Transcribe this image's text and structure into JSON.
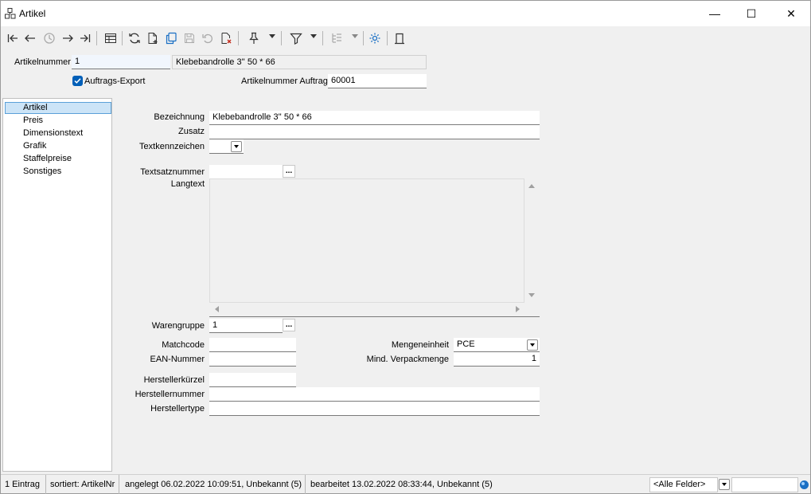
{
  "window": {
    "title": "Artikel",
    "minimize": "—",
    "maximize": "☐",
    "close": "✕"
  },
  "header": {
    "artikelnummer_label": "Artikelnummer",
    "artikelnummer_value": "1",
    "artikel_name": "Klebebandrolle 3'' 50 * 66",
    "auftrags_export_label": "Auftrags-Export",
    "auftrags_export_checked": true,
    "artikelnummer_auftrag_label": "Artikelnummer Auftrag",
    "artikelnummer_auftrag_value": "60001"
  },
  "nav": {
    "items": [
      {
        "label": "Artikel",
        "selected": true
      },
      {
        "label": "Preis",
        "selected": false
      },
      {
        "label": "Dimensionstext",
        "selected": false
      },
      {
        "label": "Grafik",
        "selected": false
      },
      {
        "label": "Staffelpreise",
        "selected": false
      },
      {
        "label": "Sonstiges",
        "selected": false
      }
    ]
  },
  "form": {
    "bezeichnung_label": "Bezeichnung",
    "bezeichnung_value": "Klebebandrolle 3'' 50 * 66",
    "zusatz_label": "Zusatz",
    "zusatz_value": "",
    "textkennzeichen_label": "Textkennzeichen",
    "textkennzeichen_value": "",
    "textsatznummer_label": "Textsatznummer",
    "textsatznummer_value": "",
    "ellipsis": "...",
    "langtext_label": "Langtext",
    "langtext_value": "",
    "warengruppe_label": "Warengruppe",
    "warengruppe_value": "1",
    "matchcode_label": "Matchcode",
    "matchcode_value": "",
    "ean_label": "EAN-Nummer",
    "ean_value": "",
    "mengeneinheit_label": "Mengeneinheit",
    "mengeneinheit_value": "PCE",
    "mind_verpackmenge_label": "Mind. Verpackmenge",
    "mind_verpackmenge_value": "1",
    "herstellerkuerzel_label": "Herstellerkürzel",
    "herstellerkuerzel_value": "",
    "herstellernummer_label": "Herstellernummer",
    "herstellernummer_value": "",
    "herstellertype_label": "Herstellertype",
    "herstellertype_value": ""
  },
  "status": {
    "count": "1 Eintrag",
    "sorted": "sortiert: ArtikelNr",
    "created": "angelegt 06.02.2022 10:09:51, Unbekannt (5)",
    "edited": "bearbeitet 13.02.2022 08:33:44, Unbekannt (5)",
    "filter_field": "<Alle Felder>",
    "search_value": ""
  },
  "colors": {
    "accent": "#005fb8",
    "selection": "#cce4f7"
  }
}
